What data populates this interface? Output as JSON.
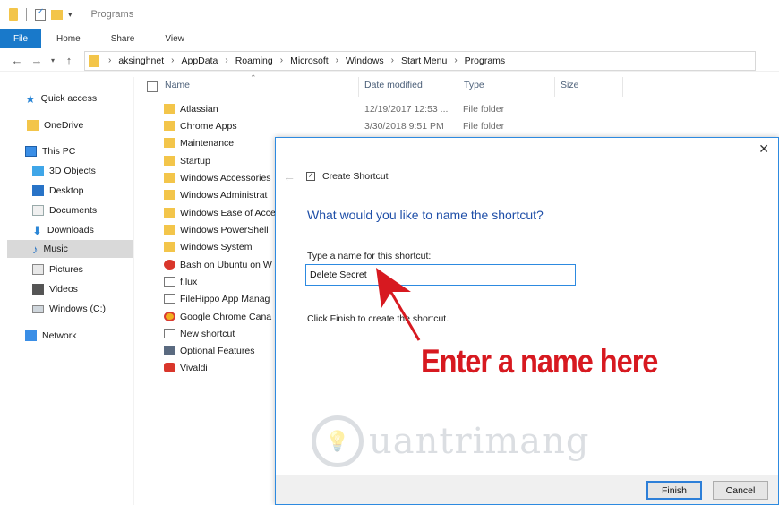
{
  "window": {
    "title": "Programs"
  },
  "ribbon": {
    "tabs": [
      "File",
      "Home",
      "Share",
      "View"
    ]
  },
  "address": {
    "crumbs": [
      "aksinghnet",
      "AppData",
      "Roaming",
      "Microsoft",
      "Windows",
      "Start Menu",
      "Programs"
    ]
  },
  "navpane": {
    "items": [
      {
        "label": "Quick access",
        "icon": "star-icon"
      },
      {
        "label": "OneDrive",
        "icon": "onedrive-icon"
      },
      {
        "label": "This PC",
        "icon": "computer-icon"
      },
      {
        "label": "3D Objects",
        "icon": "cube-icon"
      },
      {
        "label": "Desktop",
        "icon": "desktop-icon"
      },
      {
        "label": "Documents",
        "icon": "documents-icon"
      },
      {
        "label": "Downloads",
        "icon": "download-icon"
      },
      {
        "label": "Music",
        "icon": "music-icon"
      },
      {
        "label": "Pictures",
        "icon": "pictures-icon"
      },
      {
        "label": "Videos",
        "icon": "videos-icon"
      },
      {
        "label": "Windows (C:)",
        "icon": "drive-icon"
      },
      {
        "label": "Network",
        "icon": "network-icon"
      }
    ],
    "selected": "Music"
  },
  "filelist": {
    "columns": [
      "Name",
      "Date modified",
      "Type",
      "Size"
    ],
    "rows": [
      {
        "name": "Atlassian",
        "date": "12/19/2017 12:53 ...",
        "type": "File folder",
        "icon": "folder-icon"
      },
      {
        "name": "Chrome Apps",
        "date": "3/30/2018 9:51 PM",
        "type": "File folder",
        "icon": "folder-icon"
      },
      {
        "name": "Maintenance",
        "date": "",
        "type": "",
        "icon": "folder-icon"
      },
      {
        "name": "Startup",
        "date": "",
        "type": "",
        "icon": "folder-icon"
      },
      {
        "name": "Windows Accessories",
        "date": "",
        "type": "",
        "icon": "folder-icon"
      },
      {
        "name": "Windows Administrat",
        "date": "",
        "type": "",
        "icon": "folder-icon"
      },
      {
        "name": "Windows Ease of Acce",
        "date": "",
        "type": "",
        "icon": "folder-icon"
      },
      {
        "name": "Windows PowerShell",
        "date": "",
        "type": "",
        "icon": "folder-icon"
      },
      {
        "name": "Windows System",
        "date": "",
        "type": "",
        "icon": "folder-icon"
      },
      {
        "name": "Bash on Ubuntu on W",
        "date": "",
        "type": "",
        "icon": "ubuntu-icon"
      },
      {
        "name": "f.lux",
        "date": "",
        "type": "",
        "icon": "flux-icon"
      },
      {
        "name": "FileHippo App Manag",
        "date": "",
        "type": "",
        "icon": "app-icon"
      },
      {
        "name": "Google Chrome Cana",
        "date": "",
        "type": "",
        "icon": "chrome-canary-icon"
      },
      {
        "name": "New shortcut",
        "date": "",
        "type": "",
        "icon": "shortcut-icon"
      },
      {
        "name": "Optional Features",
        "date": "",
        "type": "",
        "icon": "features-icon"
      },
      {
        "name": "Vivaldi",
        "date": "",
        "type": "",
        "icon": "vivaldi-icon"
      }
    ]
  },
  "dialog": {
    "title": "Create Shortcut",
    "question": "What would you like to name the shortcut?",
    "field_label": "Type a name for this shortcut:",
    "field_value": "Delete Secret",
    "instruction": "Click Finish to create the shortcut.",
    "finish_label": "Finish",
    "cancel_label": "Cancel"
  },
  "annotation": {
    "text": "Enter a name here",
    "color": "#d71920"
  },
  "colors": {
    "accent": "#1979ca",
    "folder": "#f3c54a",
    "dialog_heading": "#1f4fa8"
  }
}
